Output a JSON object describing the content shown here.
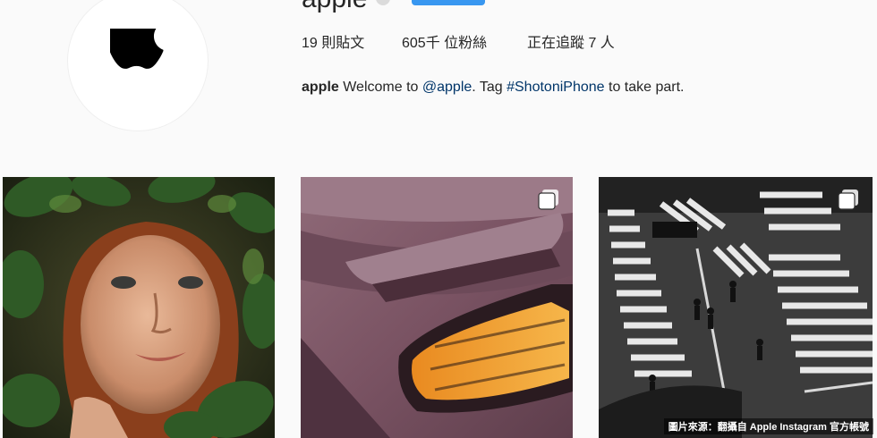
{
  "profile": {
    "username": "apple",
    "stats": {
      "posts": "19 則貼文",
      "followers": "605千 位粉絲",
      "following": "正在追蹤 7 人"
    },
    "bio": {
      "name": "apple",
      "text_1": " Welcome to ",
      "mention": "@apple",
      "text_2": ". Tag ",
      "hashtag": "#ShotoniPhone",
      "text_3": " to take part."
    },
    "avatar_icon": "apple-logo-icon",
    "accent_color": "#3897f0",
    "link_color": "#003569"
  },
  "posts": [
    {
      "subject": "girl-in-leaves"
    },
    {
      "subject": "car-tail-light",
      "icon": "multiple-posts-icon"
    },
    {
      "subject": "crosswalk-aerial",
      "icon": "multiple-posts-icon"
    }
  ],
  "credit": "圖片來源：翻攝自 Apple Instagram 官方帳號"
}
